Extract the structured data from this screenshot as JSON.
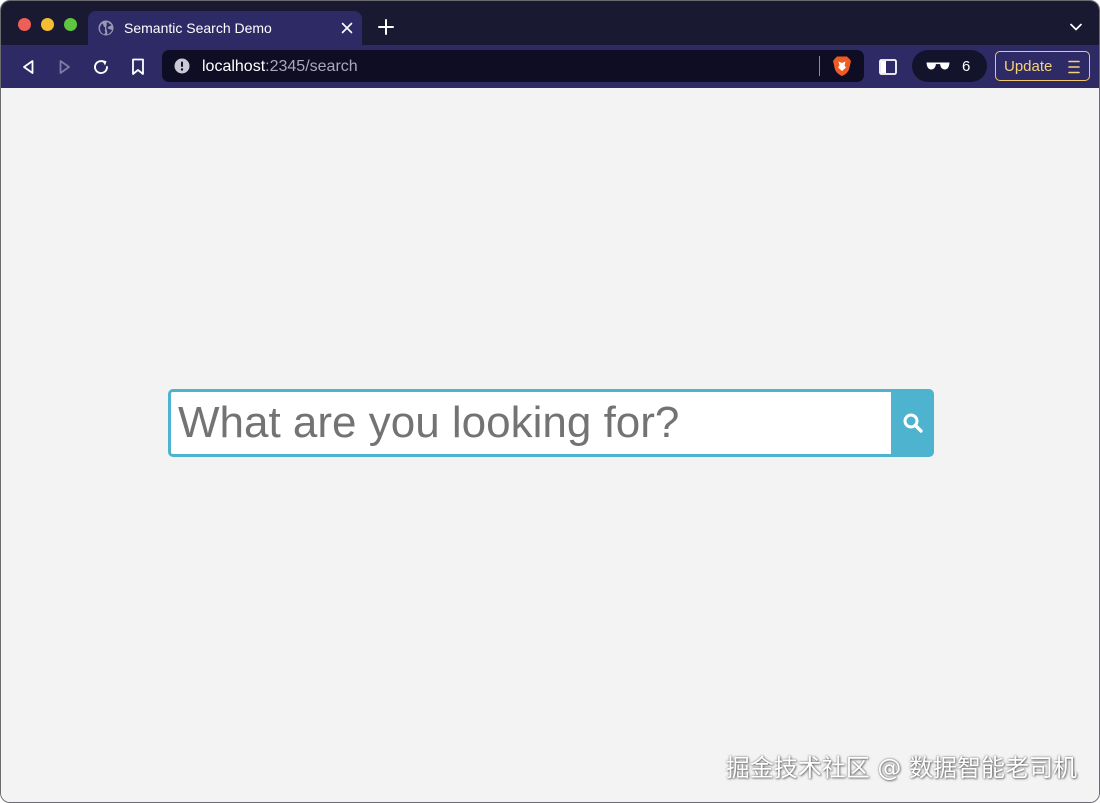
{
  "window": {
    "controls": [
      "close",
      "minimize",
      "zoom"
    ]
  },
  "tabs": [
    {
      "title": "Semantic Search Demo",
      "icon": "globe-icon",
      "active": true
    }
  ],
  "toolbar": {
    "url_host": "localhost",
    "url_path": ":2345/search",
    "rewards_count": "6",
    "update_label": "Update"
  },
  "search": {
    "placeholder": "What are you looking for?",
    "value": ""
  },
  "watermark": "掘金技术社区 @ 数据智能老司机",
  "colors": {
    "tabstrip": "#1a1932",
    "toolbar": "#2e2a66",
    "urlbar": "#0e0d24",
    "accent": "#4db3cf",
    "update_border": "#f0c86a",
    "page_bg": "#f3f3f3"
  }
}
